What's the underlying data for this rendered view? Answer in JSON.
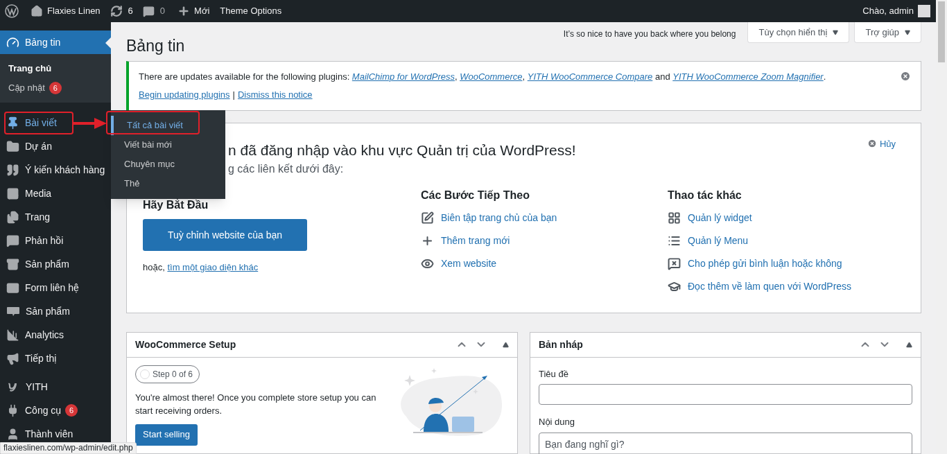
{
  "admin_bar": {
    "site_name": "Flaxies Linen",
    "updates_count": "6",
    "comments_count": "0",
    "new_label": "Mới",
    "theme_options": "Theme Options",
    "greeting": "Chào, admin"
  },
  "sidebar": {
    "groups": [
      [
        {
          "label": "Bảng tin",
          "selected": true,
          "hovered": false,
          "children": [
            {
              "label": "Trang chủ",
              "selected": true
            },
            {
              "label": "Cập nhật",
              "badge": "6",
              "selected": false
            }
          ]
        }
      ],
      [
        {
          "label": "Bài viết",
          "selected": false,
          "hovered": true
        },
        {
          "label": "Dự án",
          "selected": false,
          "hovered": false
        },
        {
          "label": "Ý kiến khách hàng",
          "selected": false,
          "hovered": false
        },
        {
          "label": "Media",
          "selected": false,
          "hovered": false
        },
        {
          "label": "Trang",
          "selected": false,
          "hovered": false
        },
        {
          "label": "Phản hồi",
          "selected": false,
          "hovered": false
        },
        {
          "label": "Sản phẩm",
          "selected": false,
          "hovered": false
        },
        {
          "label": "Form liên hệ",
          "selected": false,
          "hovered": false
        },
        {
          "label": "Sản phẩm",
          "selected": false,
          "hovered": false
        },
        {
          "label": "Analytics",
          "selected": false,
          "hovered": false
        },
        {
          "label": "Tiếp thị",
          "selected": false,
          "hovered": false
        }
      ],
      [
        {
          "label": "YITH",
          "selected": false,
          "hovered": false
        },
        {
          "label": "Công cụ",
          "badge": "6",
          "selected": false,
          "hovered": false
        },
        {
          "label": "Thành viên",
          "selected": false,
          "hovered": false
        }
      ]
    ]
  },
  "flyout": {
    "items": [
      {
        "label": "Tất cả bài viết",
        "selected": true
      },
      {
        "label": "Viết bài mới",
        "selected": false
      },
      {
        "label": "Chuyên mục",
        "selected": false
      },
      {
        "label": "Thẻ",
        "selected": false
      }
    ]
  },
  "screen_meta": {
    "tagline": "It’s so nice to have you back where you belong",
    "buttons": [
      "Tùy chọn hiển thị",
      "Trợ giúp"
    ]
  },
  "page_title": "Bảng tin",
  "notice": {
    "message": [
      {
        "kind": "text",
        "text": "There are updates available for the following plugins: "
      },
      {
        "kind": "link",
        "text": "MailChimp for WordPress"
      },
      {
        "kind": "text",
        "text": ", "
      },
      {
        "kind": "link",
        "text": "WooCommerce"
      },
      {
        "kind": "text",
        "text": ", "
      },
      {
        "kind": "link",
        "text": "YITH WooCommerce Compare"
      },
      {
        "kind": "text",
        "text": " and "
      },
      {
        "kind": "link",
        "text": "YITH WooCommerce Zoom Magnifier"
      },
      {
        "kind": "text",
        "text": "."
      }
    ],
    "actions": [
      "Begin updating plugins",
      "Dismiss this notice"
    ],
    "separator": "|"
  },
  "welcome": {
    "title": "n đã đăng nhập vào khu vực Quản trị của WordPress!",
    "subtitle": "g các liên kết dưới đây:",
    "dismiss": "Hủy",
    "start": {
      "heading": "Hãy Bắt Đầu",
      "button": "Tuỳ chỉnh website của bạn",
      "or": "hoặc, ",
      "link": "tìm một giao diện khác"
    },
    "next_steps": {
      "heading": "Các Bước Tiếp Theo",
      "links": [
        "Biên tập trang chủ của bạn",
        "Thêm trang mới",
        "Xem website"
      ]
    },
    "more_actions": {
      "heading": "Thao tác khác",
      "links": [
        "Quản lý widget",
        "Quản lý Menu",
        "Cho phép gửi bình luận hoặc không",
        "Đọc thêm về làm quen với WordPress"
      ]
    }
  },
  "woocommerce_setup": {
    "title": "WooCommerce Setup",
    "step": "Step 0 of 6",
    "text": "You're almost there! Once you complete store setup you can start receiving orders.",
    "button": "Start selling"
  },
  "draft": {
    "title": "Bản nháp",
    "title_label": "Tiêu đề",
    "content_label": "Nội dung",
    "content_placeholder": "Bạn đang nghĩ gì?"
  },
  "status_bar": "flaxieslinen.com/wp-admin/edit.php"
}
